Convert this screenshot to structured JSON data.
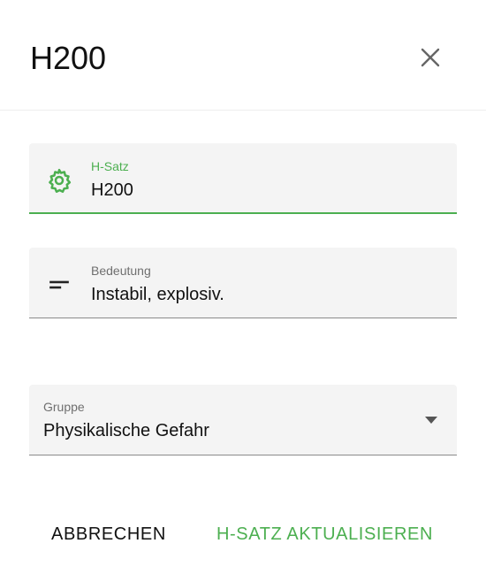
{
  "dialog": {
    "title": "H200",
    "close_icon": "close-icon"
  },
  "fields": {
    "h_satz": {
      "label": "H-Satz",
      "value": "H200",
      "icon": "gear-icon"
    },
    "bedeutung": {
      "label": "Bedeutung",
      "value": "Instabil, explosiv.",
      "icon": "short-text-icon"
    },
    "gruppe": {
      "label": "Gruppe",
      "value": "Physikalische Gefahr",
      "icon": "dropdown-arrow-icon"
    }
  },
  "actions": {
    "cancel_label": "ABBRECHEN",
    "submit_label": "H-SATZ AKTUALISIEREN"
  },
  "colors": {
    "accent": "#4caf50",
    "field_bg": "#f4f4f4"
  }
}
